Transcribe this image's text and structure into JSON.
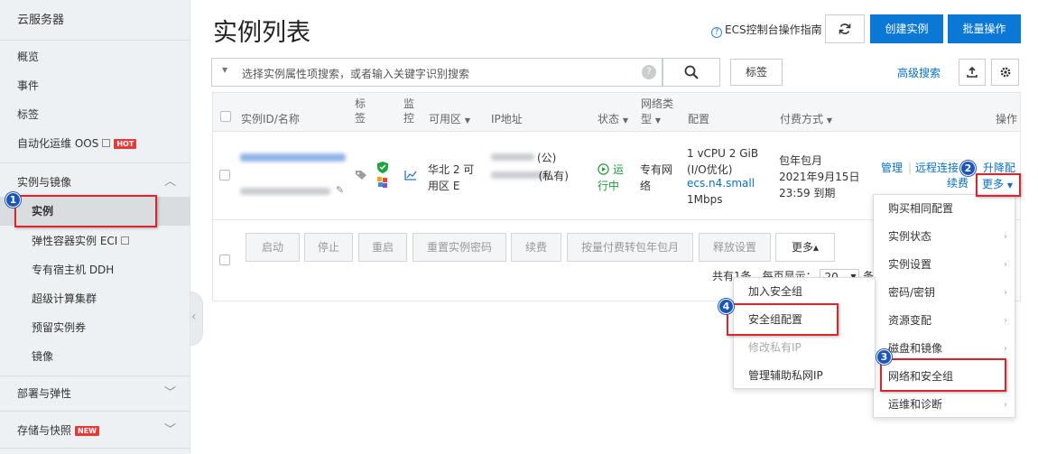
{
  "sidebar": {
    "header": "云服务器",
    "items": [
      {
        "label": "概览"
      },
      {
        "label": "事件"
      },
      {
        "label": "标签"
      },
      {
        "label": "自动化运维 OOS",
        "badge": "HOT"
      }
    ],
    "group_instances": "实例与镜像",
    "sub_items": [
      {
        "label": "实例"
      },
      {
        "label": "弹性容器实例 ECI"
      },
      {
        "label": "专有宿主机 DDH"
      },
      {
        "label": "超级计算集群"
      },
      {
        "label": "预留实例券"
      },
      {
        "label": "镜像"
      }
    ],
    "group_deploy": "部署与弹性",
    "group_storage": "存储与快照",
    "storage_badge": "NEW"
  },
  "header": {
    "title": "实例列表",
    "guide_link": "ECS控制台操作指南",
    "create_button": "创建实例",
    "batch_button": "批量操作"
  },
  "search": {
    "placeholder": "选择实例属性项搜索，或者输入关键字识别搜索",
    "tag_button": "标签",
    "advanced": "高级搜索"
  },
  "table": {
    "headers": {
      "id_name": "实例ID/名称",
      "tag": "标签",
      "monitor": "监控",
      "zone": "可用区",
      "ip": "IP地址",
      "status": "状态",
      "network": "网络类型",
      "config": "配置",
      "billing": "付费方式",
      "actions": "操作"
    },
    "row": {
      "zone": "华北 2 可用区 E",
      "ip_public_suffix": "(公)",
      "ip_private_suffix": "(私有)",
      "status": "运行中",
      "network": "专有网络",
      "config_line1": "1 vCPU 2 GiB (I/O优化)",
      "config_type": "ecs.n4.small",
      "config_bw": "1Mbps",
      "billing_line1": "包年包月",
      "billing_line2": "2021年9月15日",
      "billing_line3": "23:59 到期",
      "action_manage": "管理",
      "action_remote": "远程连接",
      "action_upgrade": "升降配",
      "action_renew": "续费",
      "action_more": "更多"
    },
    "footer_buttons": [
      "启动",
      "停止",
      "重启",
      "重置实例密码",
      "续费",
      "按量付费转包年包月",
      "释放设置",
      "更多▴"
    ],
    "pagination": {
      "prefix": "共有1条，每页显示：",
      "page_size": "20",
      "suffix": "条"
    }
  },
  "more_menu": [
    {
      "label": "购买相同配置",
      "has_sub": false
    },
    {
      "label": "实例状态",
      "has_sub": true
    },
    {
      "label": "实例设置",
      "has_sub": true
    },
    {
      "label": "密码/密钥",
      "has_sub": true
    },
    {
      "label": "资源变配",
      "has_sub": true
    },
    {
      "label": "磁盘和镜像",
      "has_sub": true
    },
    {
      "label": "网络和安全组",
      "has_sub": true
    },
    {
      "label": "运维和诊断",
      "has_sub": true
    }
  ],
  "sub_menu": [
    {
      "label": "加入安全组"
    },
    {
      "label": "安全组配置"
    },
    {
      "label": "修改私有IP",
      "disabled": true
    },
    {
      "label": "管理辅助私网IP"
    }
  ],
  "callouts": [
    "1",
    "2",
    "3",
    "4"
  ],
  "colors": {
    "primary": "#0a78d4",
    "link": "#0a6fc2",
    "running": "#1f9a3b",
    "highlight": "#d9262c",
    "callout": "#1c55b8"
  }
}
